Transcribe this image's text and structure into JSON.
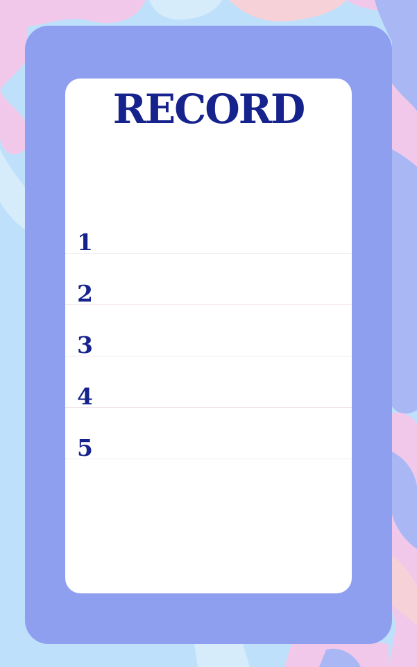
{
  "card": {
    "title": "RECORD"
  },
  "entries": [
    {
      "number": "1"
    },
    {
      "number": "2"
    },
    {
      "number": "3"
    },
    {
      "number": "4"
    },
    {
      "number": "5"
    }
  ],
  "colors": {
    "background_light_blue": "#bfe0fa",
    "background_pink": "#f1c8ea",
    "background_periwinkle": "#a9b8f4",
    "frame": "#8e9ff0",
    "card": "#ffffff",
    "text_navy": "#16238c",
    "rule_line": "#f1e6ee"
  }
}
